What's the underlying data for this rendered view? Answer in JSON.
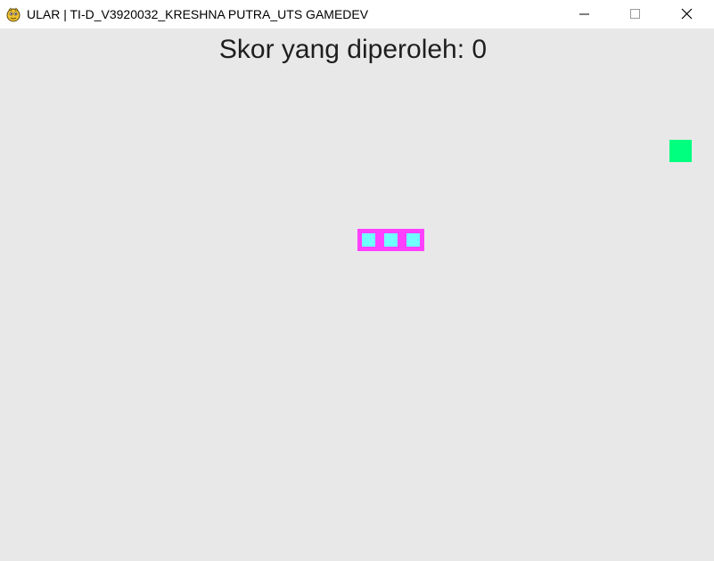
{
  "window": {
    "title": "ULAR | TI-D_V3920032_KRESHNA PUTRA_UTS GAMEDEV",
    "app_icon": "pygame-snake-icon",
    "controls": {
      "minimize_icon": "minimize-icon",
      "maximize_icon": "maximize-icon",
      "close_icon": "close-icon"
    }
  },
  "game": {
    "score_label": "Skor yang diperoleh: 0",
    "score": 0,
    "background_color": "#e8e8e8",
    "food_color": "#00ff7f",
    "snake": {
      "length": 3,
      "head_color": "#70ffff",
      "border_color": "#ff40ff"
    }
  }
}
